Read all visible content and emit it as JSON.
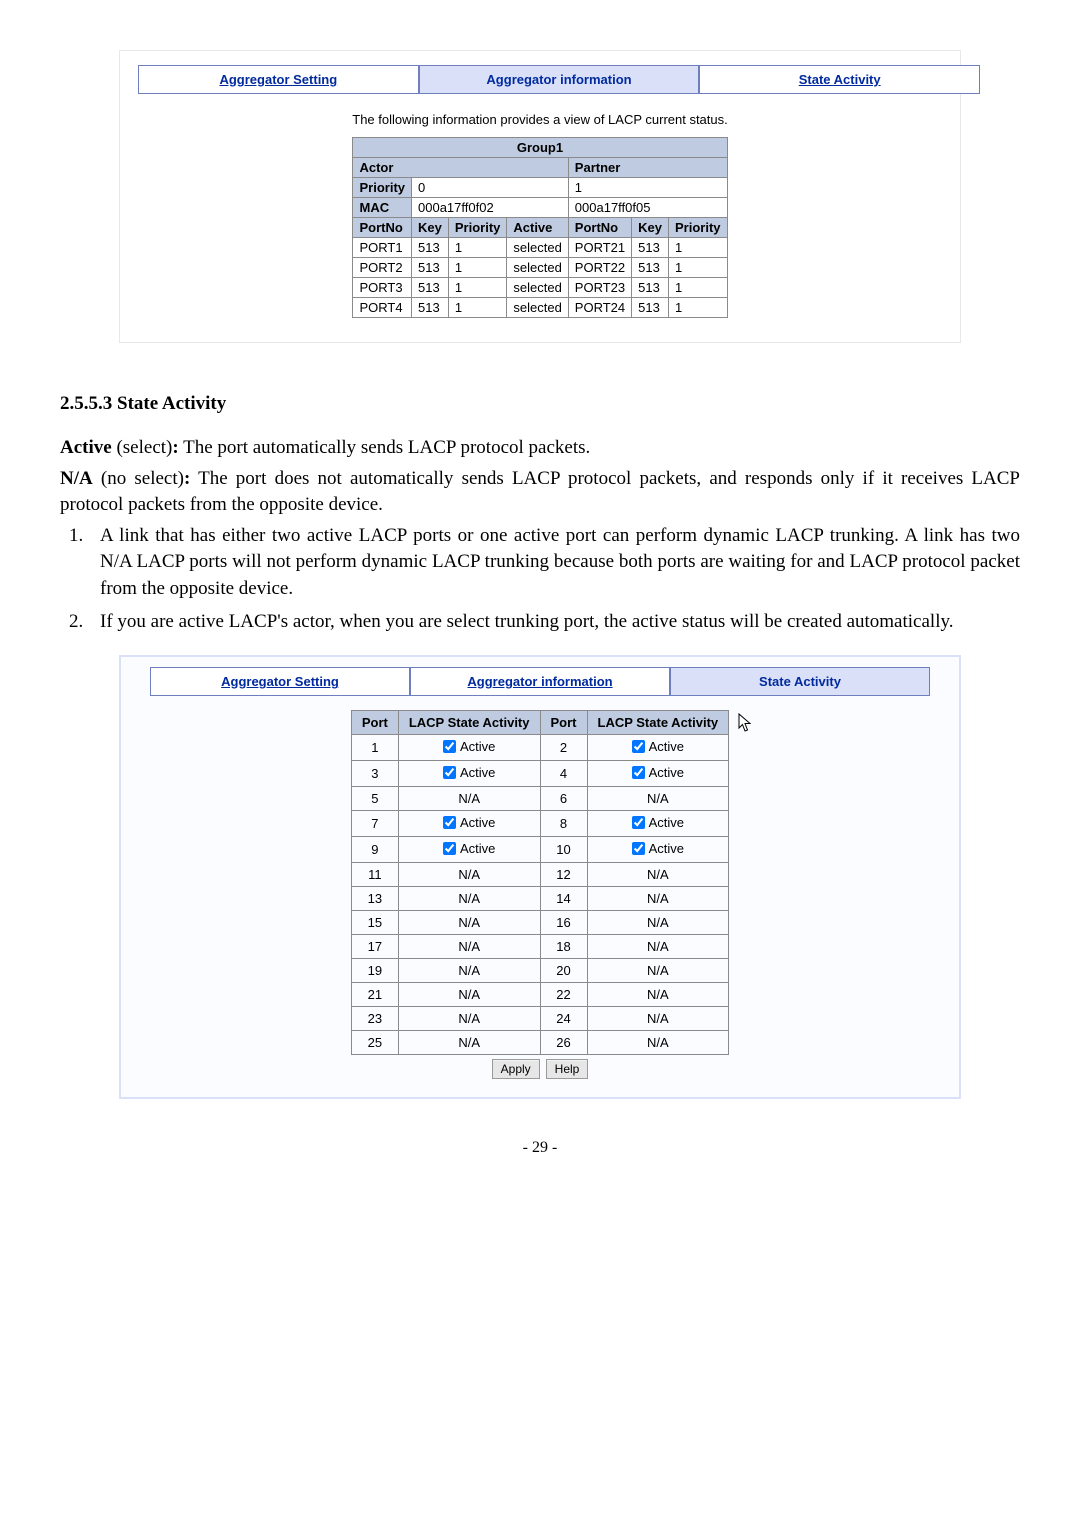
{
  "tabs1": {
    "aggregator_setting": "Aggregator Setting",
    "aggregator_information": "Aggregator information",
    "state_activity": "State Activity"
  },
  "caption1": "The following information provides a view of LACP current status.",
  "group1": {
    "header": "Group1",
    "actor_label": "Actor",
    "partner_label": "Partner",
    "priority_label": "Priority",
    "priority_actor": "0",
    "priority_partner": "1",
    "mac_label": "MAC",
    "mac_actor": "000a17ff0f02",
    "mac_partner": "000a17ff0f05",
    "cols_actor": [
      "PortNo",
      "Key",
      "Priority",
      "Active"
    ],
    "cols_partner": [
      "PortNo",
      "Key",
      "Priority"
    ],
    "rows": [
      {
        "a_port": "PORT1",
        "a_key": "513",
        "a_pri": "1",
        "a_act": "selected",
        "p_port": "PORT21",
        "p_key": "513",
        "p_pri": "1"
      },
      {
        "a_port": "PORT2",
        "a_key": "513",
        "a_pri": "1",
        "a_act": "selected",
        "p_port": "PORT22",
        "p_key": "513",
        "p_pri": "1"
      },
      {
        "a_port": "PORT3",
        "a_key": "513",
        "a_pri": "1",
        "a_act": "selected",
        "p_port": "PORT23",
        "p_key": "513",
        "p_pri": "1"
      },
      {
        "a_port": "PORT4",
        "a_key": "513",
        "a_pri": "1",
        "a_act": "selected",
        "p_port": "PORT24",
        "p_key": "513",
        "p_pri": "1"
      }
    ]
  },
  "section_heading": "2.5.5.3 State Activity",
  "para_active_label": "Active",
  "para_active_suffix": " (select)",
  "para_active_text": ": The port automatically sends LACP protocol packets.",
  "para_na_label": "N/A",
  "para_na_suffix": " (no select)",
  "para_na_text": ": The port does not automatically sends LACP protocol packets, and responds only if it receives LACP protocol packets from the opposite device.",
  "note1_num": "1.",
  "note1_text": "A link that has either two active LACP ports or one active port can perform dynamic LACP trunking. A link has two N/A LACP ports will not perform dynamic LACP trunking because both ports are waiting for and LACP protocol packet from the opposite device.",
  "note2_num": "2",
  "note2_text": ". If you are active LACP's actor, when you are select trunking port, the active status will be created automatically.",
  "tabs2": {
    "aggregator_setting": "Aggregator Setting",
    "aggregator_information": "Aggregator information",
    "state_activity": "State Activity"
  },
  "activity_table": {
    "headers": [
      "Port",
      "LACP State Activity",
      "Port",
      "LACP State Activity"
    ],
    "active_label": "Active",
    "na_label": "N/A",
    "rows": [
      {
        "p1": "1",
        "s1": "active",
        "p2": "2",
        "s2": "active"
      },
      {
        "p1": "3",
        "s1": "active",
        "p2": "4",
        "s2": "active"
      },
      {
        "p1": "5",
        "s1": "na",
        "p2": "6",
        "s2": "na"
      },
      {
        "p1": "7",
        "s1": "active",
        "p2": "8",
        "s2": "active"
      },
      {
        "p1": "9",
        "s1": "active",
        "p2": "10",
        "s2": "active"
      },
      {
        "p1": "11",
        "s1": "na",
        "p2": "12",
        "s2": "na"
      },
      {
        "p1": "13",
        "s1": "na",
        "p2": "14",
        "s2": "na"
      },
      {
        "p1": "15",
        "s1": "na",
        "p2": "16",
        "s2": "na"
      },
      {
        "p1": "17",
        "s1": "na",
        "p2": "18",
        "s2": "na"
      },
      {
        "p1": "19",
        "s1": "na",
        "p2": "20",
        "s2": "na"
      },
      {
        "p1": "21",
        "s1": "na",
        "p2": "22",
        "s2": "na"
      },
      {
        "p1": "23",
        "s1": "na",
        "p2": "24",
        "s2": "na"
      },
      {
        "p1": "25",
        "s1": "na",
        "p2": "26",
        "s2": "na"
      }
    ]
  },
  "buttons": {
    "apply": "Apply",
    "help": "Help"
  },
  "page_number": "- 29 -"
}
